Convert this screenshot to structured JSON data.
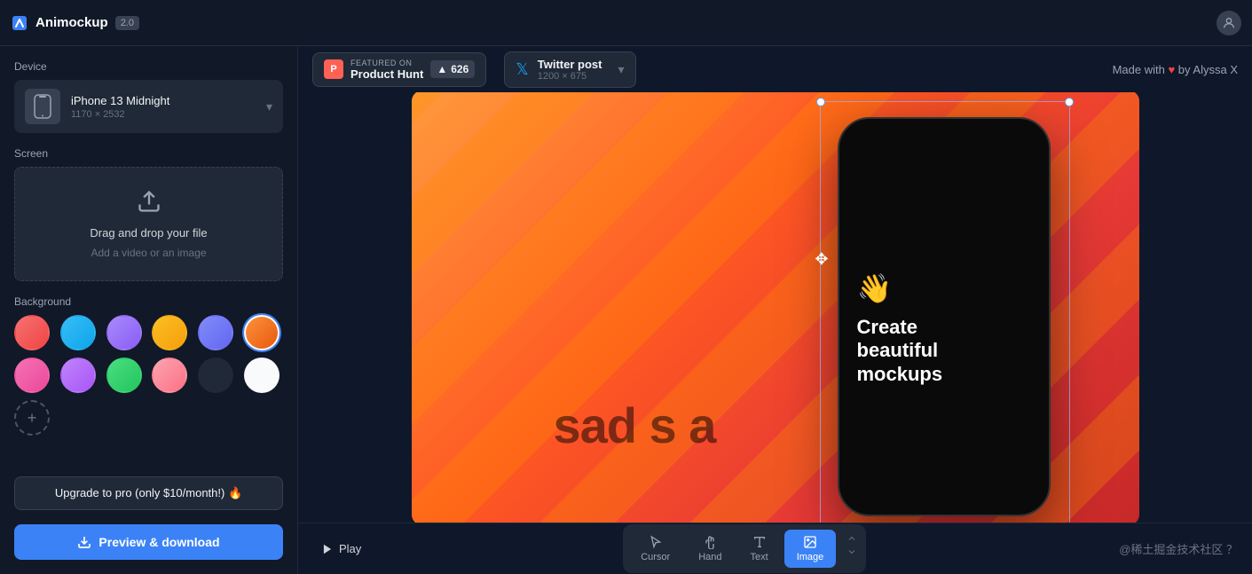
{
  "app": {
    "name": "Animockup",
    "version": "2.0",
    "made_with": "Made with",
    "made_by": "by Alyssa X"
  },
  "topbar": {
    "profile_icon": "person"
  },
  "sidebar": {
    "device_section_label": "Device",
    "device_name": "iPhone 13 Midnight",
    "device_dims": "1170 × 2532",
    "screen_section_label": "Screen",
    "upload_primary": "Drag and drop your file",
    "upload_secondary": "Add a video or an image",
    "background_section_label": "Background",
    "upgrade_label": "Upgrade to pro (only $10/month!) 🔥",
    "preview_label": "Preview & download"
  },
  "producthunt": {
    "featured_text": "FEATURED ON",
    "product_name": "Product Hunt",
    "upvote_icon": "▲",
    "upvote_count": "626"
  },
  "twitter_badge": {
    "post_name": "Twitter post",
    "dims": "1200 × 675"
  },
  "canvas": {
    "text_overlay": "sad s a",
    "move_cursor": "✥"
  },
  "phone": {
    "emoji": "👋",
    "headline_line1": "Create",
    "headline_line2": "beautiful",
    "headline_line3": "mockups"
  },
  "toolbar": {
    "play_label": "Play",
    "cursor_label": "Cursor",
    "hand_label": "Hand",
    "text_label": "Text",
    "image_label": "Image"
  },
  "community": {
    "tag": "@稀土掘金技术社区 ？"
  },
  "swatches": [
    {
      "id": "swatch-1",
      "color": "#f87171"
    },
    {
      "id": "swatch-2",
      "color": "#38bdf8"
    },
    {
      "id": "swatch-3",
      "color": "#a78bfa"
    },
    {
      "id": "swatch-4",
      "color": "#fbbf24"
    },
    {
      "id": "swatch-5",
      "color": "#818cf8"
    },
    {
      "id": "swatch-6",
      "color": "#fb923c",
      "active": true
    },
    {
      "id": "swatch-7",
      "color": "#f472b6"
    },
    {
      "id": "swatch-8",
      "color": "#c084fc"
    },
    {
      "id": "swatch-9",
      "color": "#4ade80"
    },
    {
      "id": "swatch-10",
      "color": "#fda4af"
    },
    {
      "id": "swatch-11",
      "color": "#1f2937"
    },
    {
      "id": "swatch-12",
      "color": "#f9fafb"
    }
  ]
}
